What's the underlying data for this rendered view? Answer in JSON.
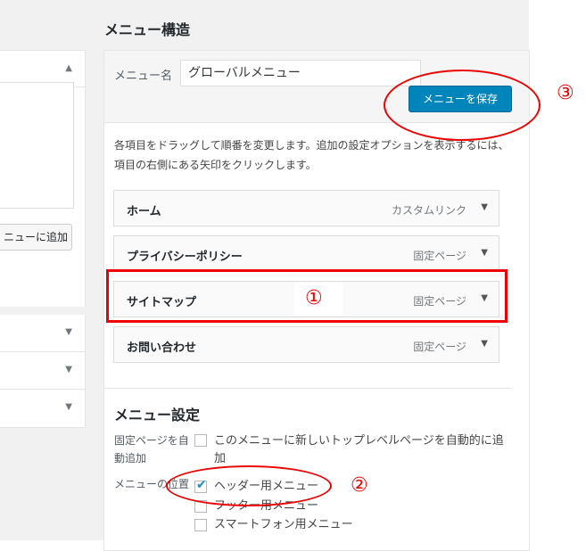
{
  "structure_title": "メニュー構造",
  "menu_name_label": "メニュー名",
  "menu_name_value": "グローバルメニュー",
  "save_label": "メニューを保存",
  "description": "各項目をドラッグして順番を変更します。追加の設定オプションを表示するには、項目の右側にある矢印をクリックします。",
  "left_add_button": "ニューに追加",
  "menu_items": [
    {
      "name": "ホーム",
      "type": "カスタムリンク"
    },
    {
      "name": "プライバシーポリシー",
      "type": "固定ページ"
    },
    {
      "name": "サイトマップ",
      "type": "固定ページ"
    },
    {
      "name": "お問い合わせ",
      "type": "固定ページ"
    }
  ],
  "settings": {
    "title": "メニュー設定",
    "auto_add_label": "固定ページを自動追加",
    "auto_add_text": "このメニューに新しいトップレベルページを自動的に追加",
    "auto_add_checked": false,
    "location_label": "メニューの位置",
    "locations": [
      {
        "label": "ヘッダー用メニュー",
        "checked": true
      },
      {
        "label": "フッター用メニュー",
        "checked": false
      },
      {
        "label": "スマートフォン用メニュー",
        "checked": false
      }
    ]
  },
  "annotations": {
    "one": "①",
    "two": "②",
    "three": "③"
  },
  "colors": {
    "primary": "#0085ba",
    "annotation": "#ee0000",
    "checkmark": "#1e8cbe"
  }
}
